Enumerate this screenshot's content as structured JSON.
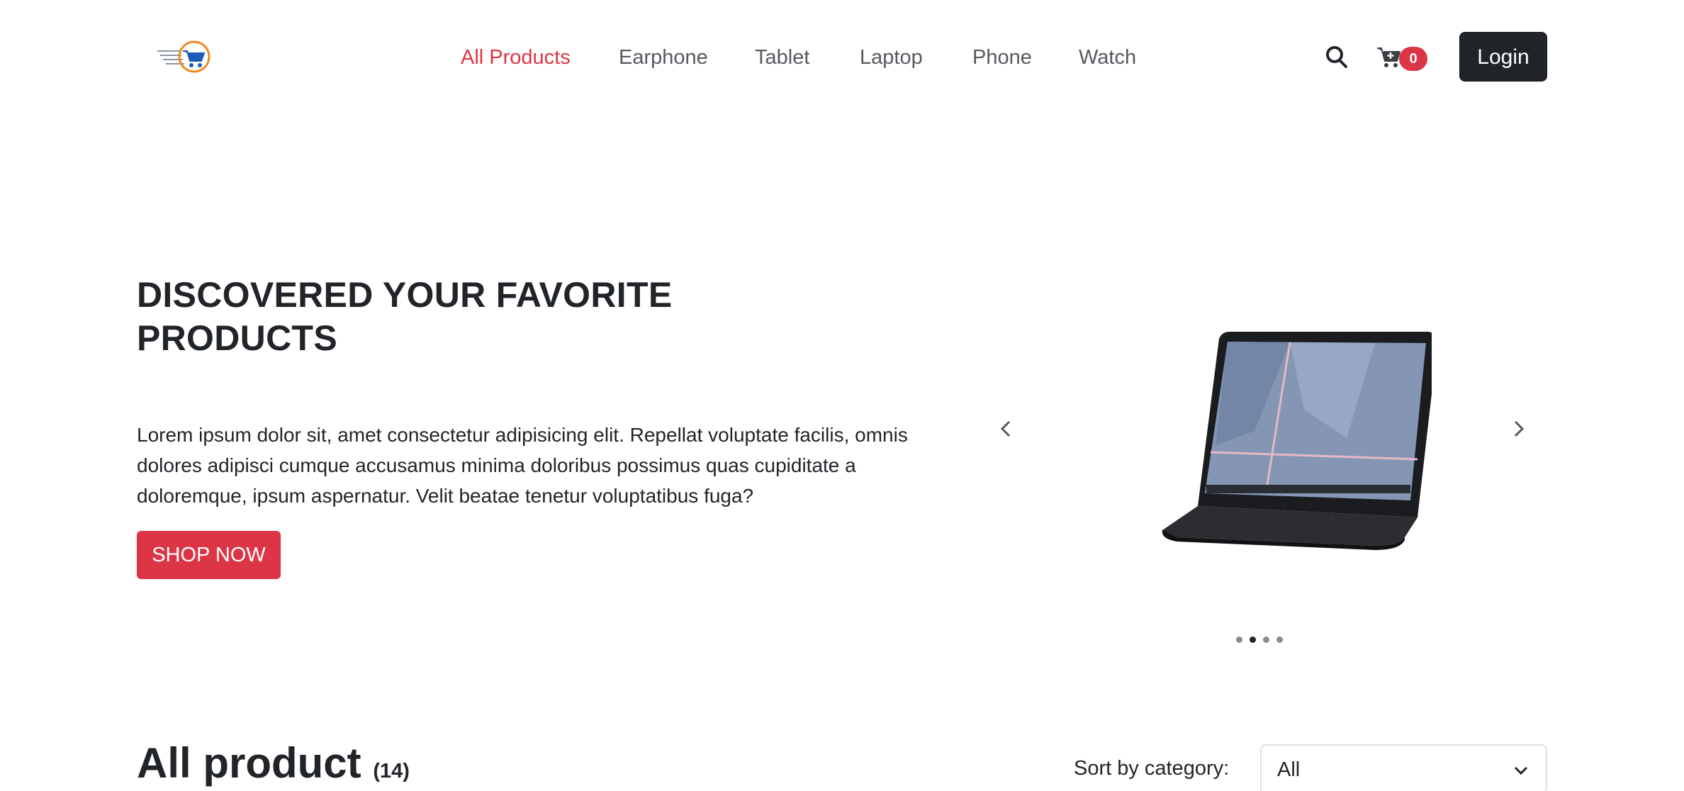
{
  "header": {
    "nav": [
      {
        "label": "All Products",
        "active": true
      },
      {
        "label": "Earphone",
        "active": false
      },
      {
        "label": "Tablet",
        "active": false
      },
      {
        "label": "Laptop",
        "active": false
      },
      {
        "label": "Phone",
        "active": false
      },
      {
        "label": "Watch",
        "active": false
      }
    ],
    "cart_count": "0",
    "login_label": "Login",
    "icons": {
      "logo": "cart-logo-icon",
      "search": "search-icon",
      "cart": "cart-plus-icon"
    }
  },
  "hero": {
    "title_line1": "DISCOVERED YOUR FAVORITE",
    "title_line2": "PRODUCTS",
    "text": "Lorem ipsum dolor sit, amet consectetur adipisicing elit. Repellat voluptate facilis, omnis dolores adipisci cumque accusamus minima doloribus possimus quas cupiditate a doloremque, ipsum aspernatur. Velit beatae tenetur voluptatibus fuga?",
    "cta_label": "SHOP NOW"
  },
  "carousel": {
    "slides": 4,
    "active_index": 1,
    "icons": {
      "prev": "chevron-left-icon",
      "next": "chevron-right-icon",
      "image": "laptop-image"
    }
  },
  "products": {
    "title": "All product",
    "count": "(14)",
    "sort_label": "Sort by category:",
    "sort_value": "All"
  },
  "colors": {
    "accent": "#dc3545",
    "dark": "#212529",
    "nav_text": "#555a60"
  }
}
